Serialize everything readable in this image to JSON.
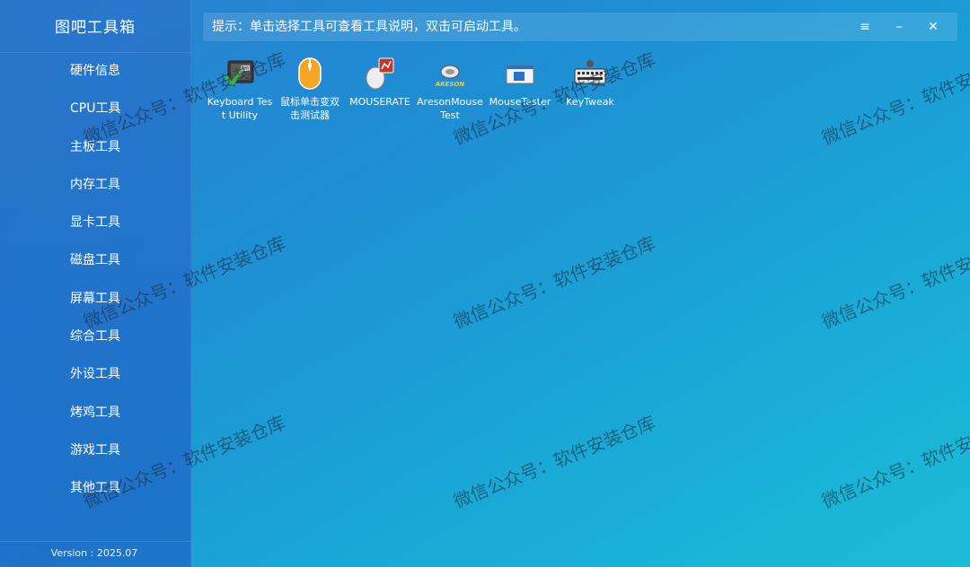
{
  "app": {
    "title": "图吧工具箱",
    "version": "Version : 2025.07"
  },
  "sidebar": {
    "items": [
      {
        "label": "硬件信息"
      },
      {
        "label": "CPU工具"
      },
      {
        "label": "主板工具"
      },
      {
        "label": "内存工具"
      },
      {
        "label": "显卡工具"
      },
      {
        "label": "磁盘工具"
      },
      {
        "label": "屏幕工具"
      },
      {
        "label": "综合工具"
      },
      {
        "label": "外设工具"
      },
      {
        "label": "烤鸡工具"
      },
      {
        "label": "游戏工具"
      },
      {
        "label": "其他工具"
      }
    ]
  },
  "hint": {
    "text": "提示：单击选择工具可查看工具说明，双击可启动工具。"
  },
  "window_controls": {
    "menu": "≡",
    "minimize": "–",
    "close": "✕"
  },
  "tools": [
    {
      "label": "Keyboard Test Utility",
      "icon": "keyboard-test-icon"
    },
    {
      "label": "鼠标单击变双击测试器",
      "icon": "mouse-orange-icon"
    },
    {
      "label": "MOUSERATE",
      "icon": "mouserate-icon"
    },
    {
      "label": "AresonMouseTest",
      "icon": "areson-mouse-icon"
    },
    {
      "label": "MouseTester",
      "icon": "mousetester-icon"
    },
    {
      "label": "KeyTweak",
      "icon": "keytweak-icon"
    }
  ],
  "watermark": {
    "text": "微信公众号：软件安装仓库",
    "areson_logo": "ARESON"
  },
  "colors": {
    "accent": "#1e8fd3",
    "sidebar": "#2a6fc8"
  }
}
